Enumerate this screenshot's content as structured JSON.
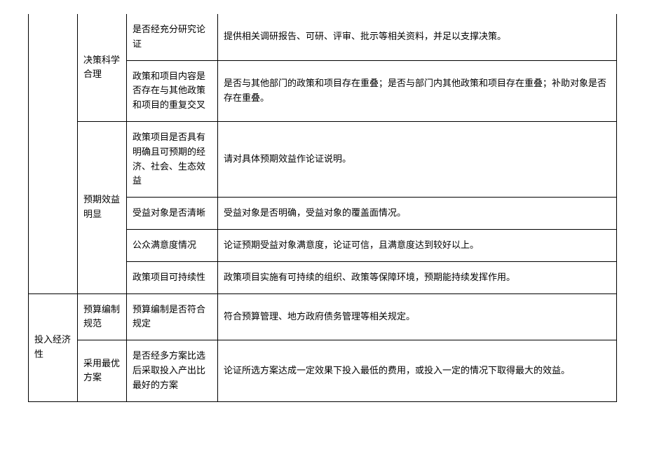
{
  "rows": [
    {
      "category": "",
      "subcategory": "决策科学合理",
      "items": [
        {
          "indicator": "是否经充分研究论证",
          "description": "提供相关调研报告、可研、评审、批示等相关资料，并足以支撑决策。"
        },
        {
          "indicator": "政策和项目内容是否存在与其他政策和项目的重复交叉",
          "description": "是否与其他部门的政策和项目存在重叠；是否与部门内其他政策和项目存在重叠；补助对象是否存在重叠。"
        }
      ]
    },
    {
      "category": "",
      "subcategory": "预期效益明显",
      "items": [
        {
          "indicator": "政策项目是否具有明确且可预期的经济、社会、生态效益",
          "description": "请对具体预期效益作论证说明。"
        },
        {
          "indicator": "受益对象是否清晰",
          "description": "受益对象是否明确，受益对象的覆盖面情况。"
        },
        {
          "indicator": "公众满意度情况",
          "description": "论证预期受益对象满意度，论证可信，且满意度达到较好以上。"
        },
        {
          "indicator": "政策项目可持续性",
          "description": "政策项目实施有可持续的组织、政策等保障环境，预期能持续发挥作用。"
        }
      ]
    },
    {
      "category": "投入经济性",
      "subcategory_a": "预算编制规范",
      "subcategory_b": "采用最优方案",
      "items": [
        {
          "indicator": "预算编制是否符合规定",
          "description": "符合预算管理、地方政府债务管理等相关规定。"
        },
        {
          "indicator": "是否经多方案比选后采取投入产出比最好的方案",
          "description": "论证所选方案达成一定效果下投入最低的费用，或投入一定的情况下取得最大的效益。"
        }
      ]
    }
  ]
}
